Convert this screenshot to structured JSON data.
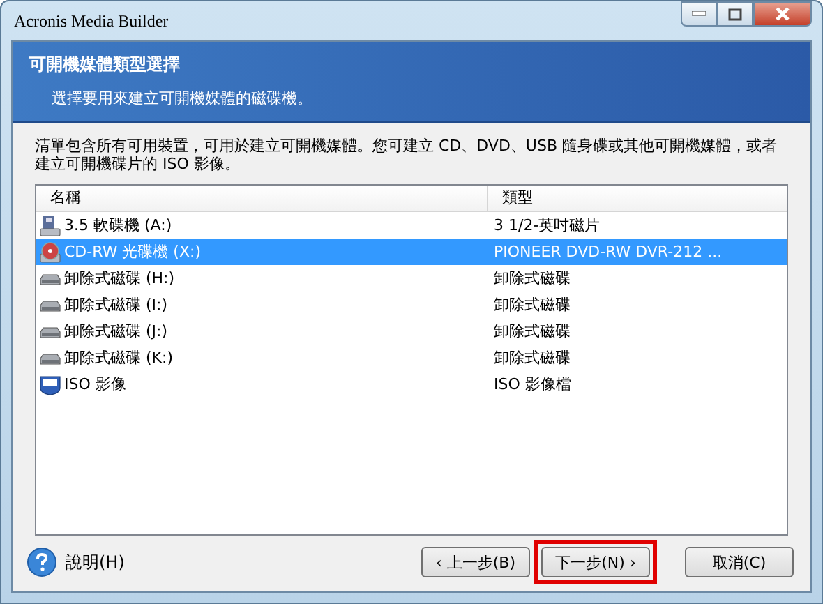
{
  "window": {
    "title": "Acronis Media Builder"
  },
  "header": {
    "title": "可開機媒體類型選擇",
    "subtitle": "選擇要用來建立可開機媒體的磁碟機。"
  },
  "description": "清單包含所有可用裝置，可用於建立可開機媒體。您可建立 CD、DVD、USB 隨身碟或其他可開機媒體，或者建立可開機碟片的 ISO 影像。",
  "table": {
    "columns": [
      "名稱",
      "類型"
    ],
    "rows": [
      {
        "kind": "floppy",
        "name": "3.5 軟碟機 (A:)",
        "type": "3 1/2-英吋磁片",
        "selected": false
      },
      {
        "kind": "optical",
        "name": "CD-RW 光碟機 (X:)",
        "type": "PIONEER DVD-RW  DVR-212 ...",
        "selected": true
      },
      {
        "kind": "removable",
        "name": "卸除式磁碟 (H:)",
        "type": "卸除式磁碟",
        "selected": false
      },
      {
        "kind": "removable",
        "name": "卸除式磁碟 (I:)",
        "type": "卸除式磁碟",
        "selected": false
      },
      {
        "kind": "removable",
        "name": "卸除式磁碟 (J:)",
        "type": "卸除式磁碟",
        "selected": false
      },
      {
        "kind": "removable",
        "name": "卸除式磁碟 (K:)",
        "type": "卸除式磁碟",
        "selected": false
      },
      {
        "kind": "iso",
        "name": "ISO 影像",
        "type": "ISO 影像檔",
        "selected": false
      }
    ]
  },
  "help": {
    "label": "說明(H)"
  },
  "buttons": [
    {
      "label": "‹ 上一步(B)",
      "highlighted": false
    },
    {
      "label": "下一步(N) ›",
      "highlighted": true
    },
    {
      "label": "取消(C)",
      "highlighted": false
    }
  ]
}
